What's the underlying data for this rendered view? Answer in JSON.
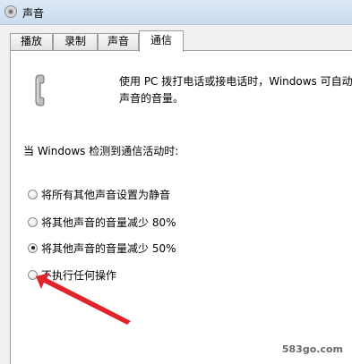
{
  "window": {
    "title": "声音"
  },
  "tabs": [
    {
      "label": "播放"
    },
    {
      "label": "录制"
    },
    {
      "label": "声音"
    },
    {
      "label": "通信"
    }
  ],
  "description": {
    "line1": "使用 PC 拨打电话或接电话时，Windows 可自动",
    "line2": "声音的音量。"
  },
  "detect_label": "当 Windows 检测到通信活动时:",
  "options": [
    {
      "label": "将所有其他声音设置为静音",
      "checked": false
    },
    {
      "label": "将其他声音的音量减少 80%",
      "checked": false
    },
    {
      "label": "将其他声音的音量减少 50%",
      "checked": true
    },
    {
      "label": "不执行任何操作",
      "checked": false
    }
  ],
  "watermark": "583go.com",
  "colors": {
    "arrow": "#e0242b",
    "titlebar": "#d3e3f2"
  }
}
